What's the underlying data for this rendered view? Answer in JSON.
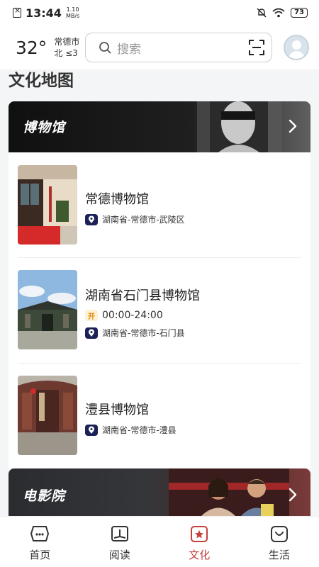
{
  "status_bar": {
    "time": "13:44",
    "net_speed_value": "1.10",
    "net_speed_unit": "MB/s",
    "battery": "73"
  },
  "header": {
    "temperature": "32°",
    "city": "常德市",
    "wind": "北 ≤3",
    "search_placeholder": "搜索"
  },
  "section_title": "文化地图",
  "museum_card": {
    "title": "博物馆",
    "items": [
      {
        "name": "常德博物馆",
        "location": "湖南省-常德市-武陵区"
      },
      {
        "name": "湖南省石门县博物馆",
        "open_badge": "开",
        "hours": "00:00-24:00",
        "location": "湖南省-常德市-石门县"
      },
      {
        "name": "澧县博物馆",
        "location": "湖南省-常德市-澧县"
      }
    ]
  },
  "cinema_card": {
    "title": "电影院"
  },
  "bottom_nav": [
    {
      "label": "首页",
      "icon": "home-icon"
    },
    {
      "label": "阅读",
      "icon": "book-icon"
    },
    {
      "label": "文化",
      "icon": "culture-icon",
      "active": true
    },
    {
      "label": "生活",
      "icon": "life-icon"
    }
  ],
  "colors": {
    "accent": "#c5403d",
    "location_badge": "#1c2257",
    "card_header_bg": "#101010"
  }
}
